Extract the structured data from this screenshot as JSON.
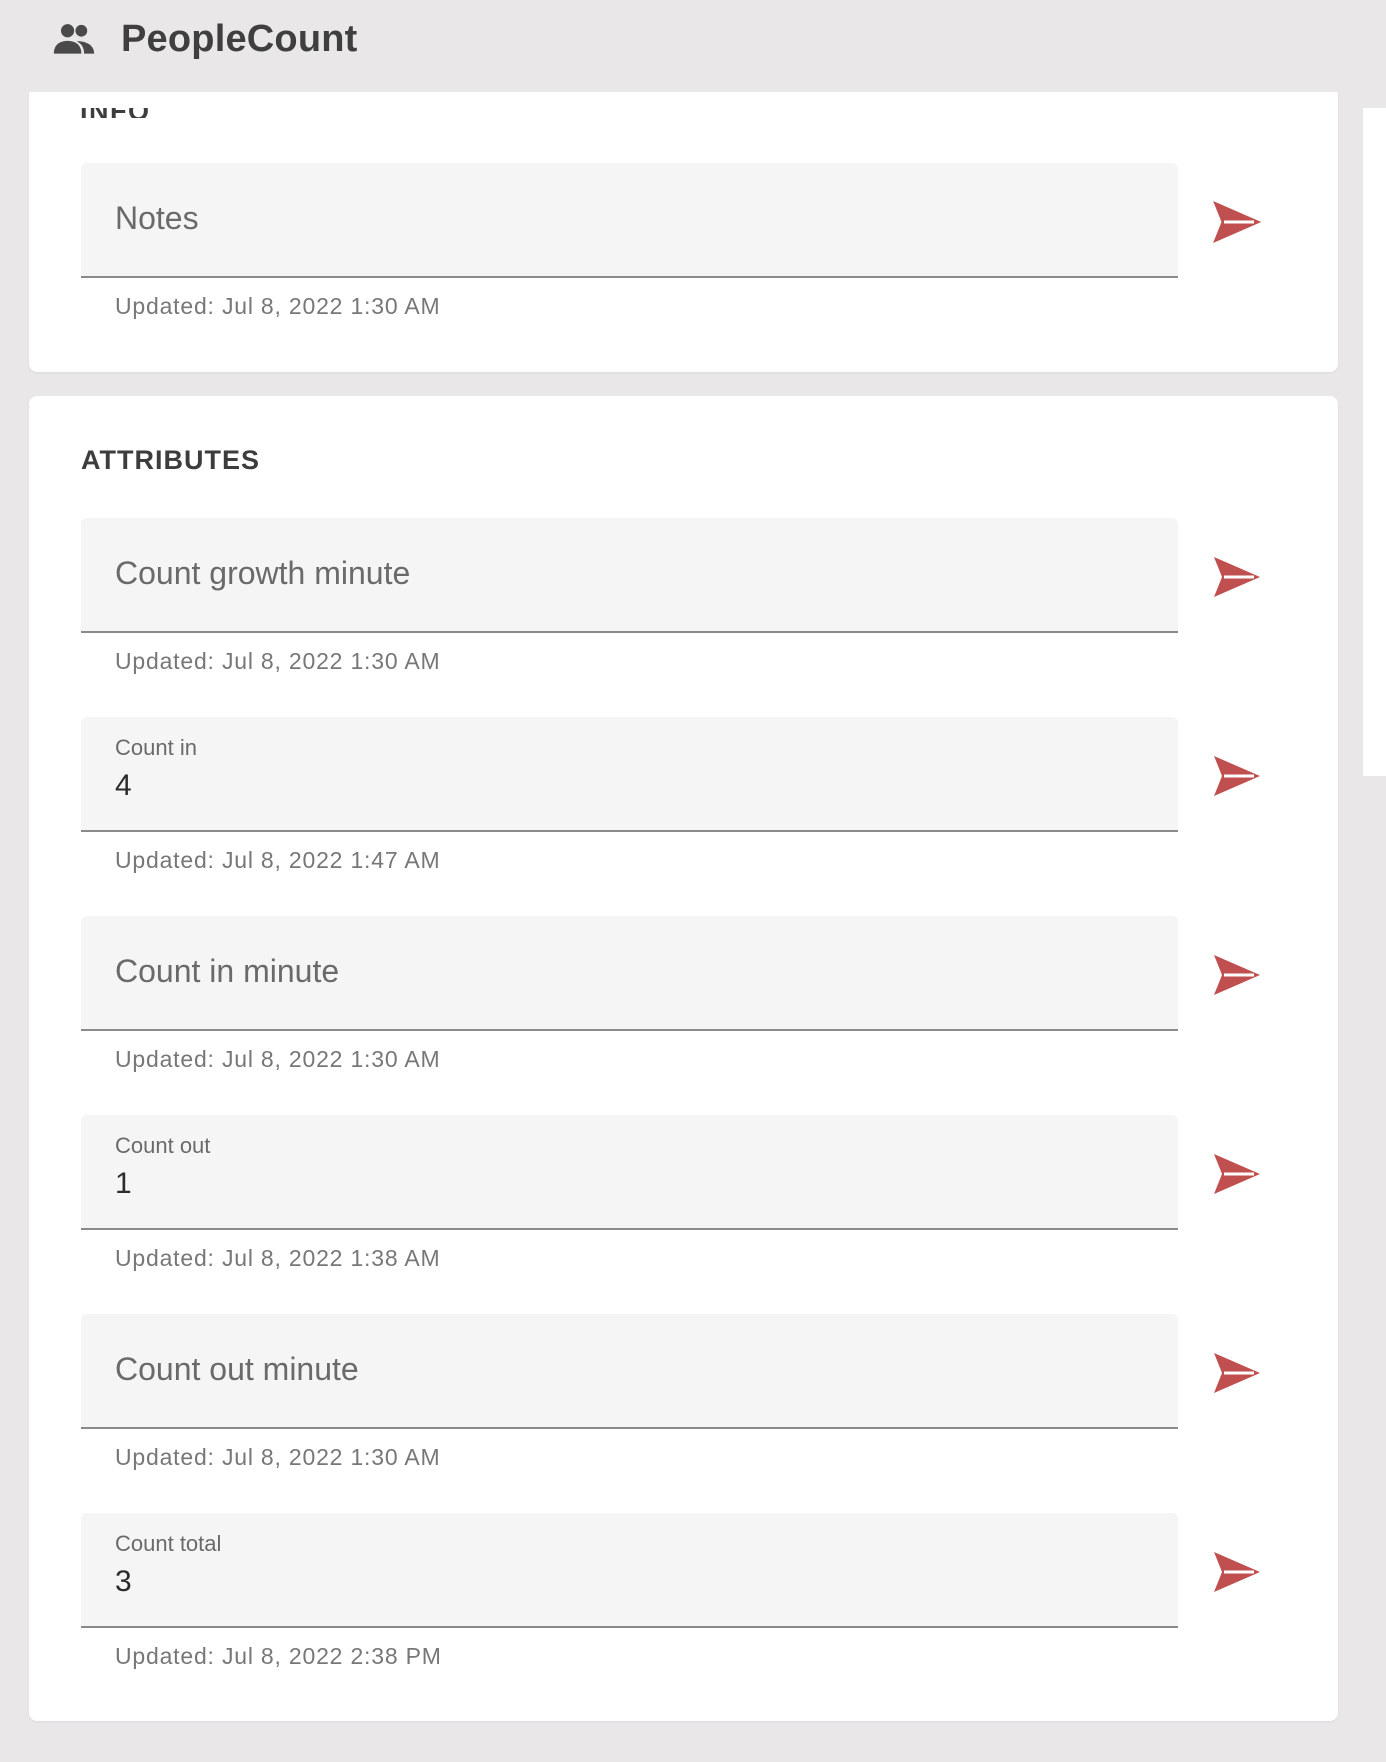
{
  "app": {
    "title": "PeopleCount",
    "icon": "people-icon"
  },
  "colors": {
    "accent": "#c0504f",
    "background": "#e9e7e8",
    "card": "#ffffff",
    "field": "#f5f5f5"
  },
  "info_section": {
    "title": "INFO",
    "fields": [
      {
        "label": "Notes",
        "value": "",
        "updated": "Updated: Jul 8, 2022 1:30 AM"
      }
    ]
  },
  "attributes_section": {
    "title": "ATTRIBUTES",
    "fields": [
      {
        "label": "Count growth minute",
        "value": "",
        "updated": "Updated: Jul 8, 2022 1:30 AM"
      },
      {
        "label": "Count in",
        "value": "4",
        "updated": "Updated: Jul 8, 2022 1:47 AM"
      },
      {
        "label": "Count in minute",
        "value": "",
        "updated": "Updated: Jul 8, 2022 1:30 AM"
      },
      {
        "label": "Count out",
        "value": "1",
        "updated": "Updated: Jul 8, 2022 1:38 AM"
      },
      {
        "label": "Count out minute",
        "value": "",
        "updated": "Updated: Jul 8, 2022 1:30 AM"
      },
      {
        "label": "Count total",
        "value": "3",
        "updated": "Updated: Jul 8, 2022 2:38 PM"
      }
    ]
  },
  "icons": {
    "send": "send-icon"
  }
}
